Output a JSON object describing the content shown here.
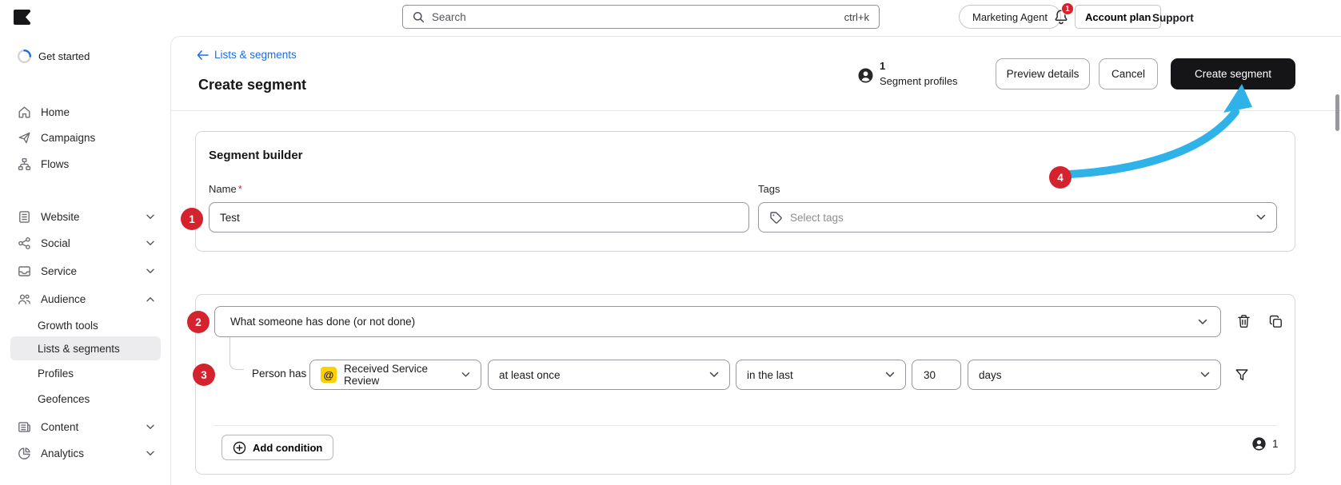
{
  "topbar": {
    "search_placeholder": "Search",
    "search_shortcut": "ctrl+k",
    "agent_button": "Marketing Agent",
    "notification_badge": "1",
    "account_plan_button": "Account plan",
    "support_link": "Support"
  },
  "sidebar": {
    "get_started": "Get started",
    "items": {
      "home": "Home",
      "campaigns": "Campaigns",
      "flows": "Flows",
      "website": "Website",
      "social": "Social",
      "service": "Service",
      "audience": "Audience",
      "content": "Content",
      "analytics": "Analytics"
    },
    "audience_children": {
      "growth_tools": "Growth tools",
      "lists_segments": "Lists & segments",
      "profiles": "Profiles",
      "geofences": "Geofences"
    },
    "selected_item": "Lists & segments"
  },
  "header": {
    "breadcrumb": "Lists & segments",
    "title": "Create segment",
    "profiles_count": "1",
    "profiles_label": "Segment profiles",
    "preview_button": "Preview details",
    "cancel_button": "Cancel",
    "create_button": "Create segment"
  },
  "builder": {
    "card_title": "Segment builder",
    "name_label": "Name",
    "required_mark": "*",
    "name_value": "Test",
    "tags_label": "Tags",
    "tags_placeholder": "Select tags"
  },
  "condition": {
    "definition_value": "What someone has done (or not done)",
    "person_prefix": "Person has",
    "metric_icon_glyph": "@",
    "metric_value": "Received Service Review",
    "frequency_value": "at least once",
    "range_value": "in the last",
    "range_number": "30",
    "range_unit": "days",
    "add_condition": "Add condition",
    "matching_count": "1"
  },
  "annotations": {
    "step1": "1",
    "step2": "2",
    "step3": "3",
    "step4": "4"
  },
  "colors": {
    "accent_blue": "#1f6be8",
    "annotation_red": "#d4232f",
    "arrow_blue": "#2fb2e8",
    "metric_yellow": "#fdd000",
    "primary_button_bg": "#151518"
  }
}
